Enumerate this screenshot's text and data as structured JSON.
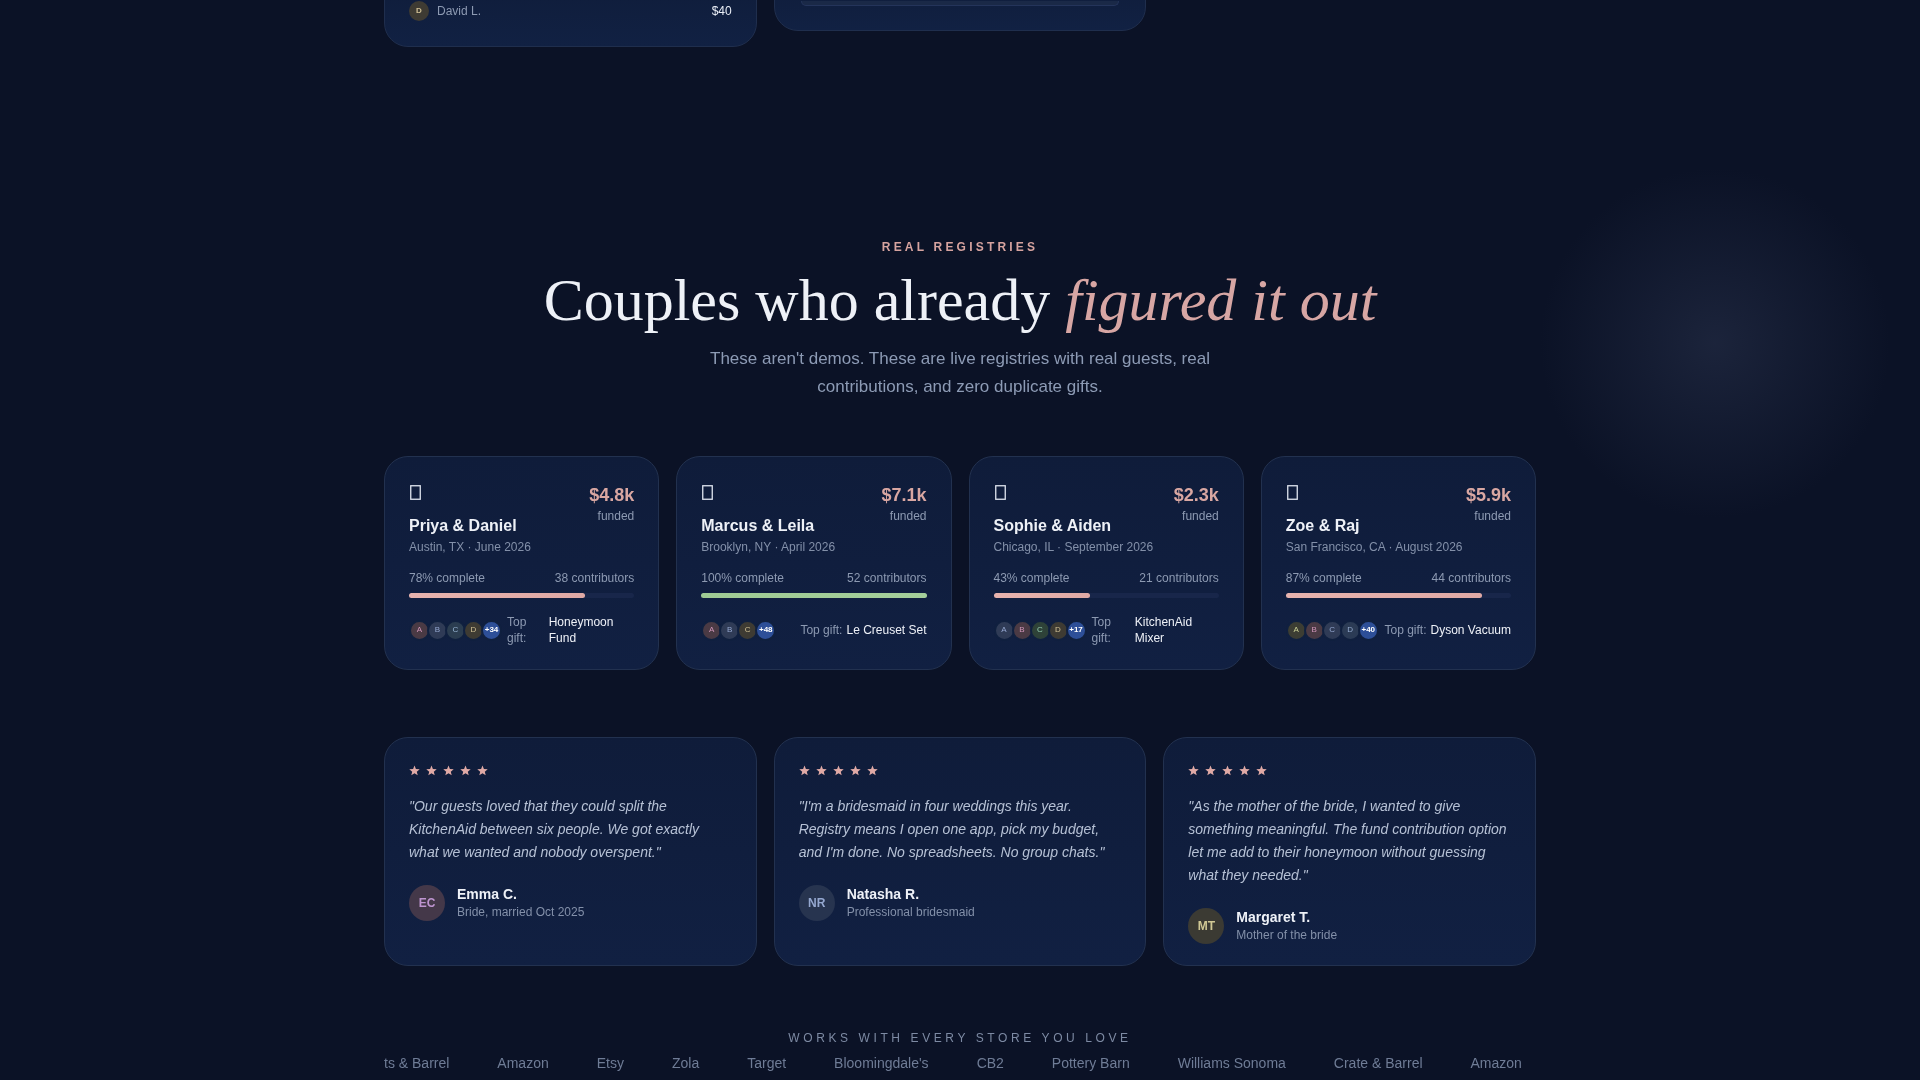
{
  "previous_cards": [
    {
      "kind": "contributions",
      "rows": [
        {
          "initial": "D",
          "name": "David L.",
          "amount": "$40",
          "color": "#3e3b33"
        }
      ]
    },
    {
      "kind": "bar"
    }
  ],
  "registries_section": {
    "eyebrow": "REAL REGISTRIES",
    "title": "Couples who already *figured it out*",
    "subtitle": "These aren't demos. These are live registries with real guests, real contributions, and zero duplicate gifts."
  },
  "registries": [
    {
      "amount": "$4.8k",
      "amount_label": "funded",
      "couple": "Priya & Daniel",
      "place": "Austin, TX · June 2026",
      "progress_label": "78% complete",
      "contributors": "38 contributors",
      "level": 0.78,
      "avatars": [
        {
          "letter": "A",
          "color": "#4a3a44"
        },
        {
          "letter": "B",
          "color": "#2f3b56"
        },
        {
          "letter": "C",
          "color": "#2b3d50"
        },
        {
          "letter": "D",
          "color": "#3e3b33"
        }
      ],
      "more": "+34",
      "gift_label": "Top gift:",
      "gift": "Honeymoon Fund"
    },
    {
      "amount": "$7.1k",
      "amount_label": "funded",
      "couple": "Marcus & Leila",
      "place": "Brooklyn, NY · April 2026",
      "progress_label": "100% complete",
      "contributors": "52 contributors",
      "level": 1,
      "avatars": [
        {
          "letter": "A",
          "color": "#4a3a44"
        },
        {
          "letter": "B",
          "color": "#2f3b56"
        },
        {
          "letter": "C",
          "color": "#3e3b33"
        }
      ],
      "more": "+48",
      "gift_label": "Top gift:",
      "gift": "Le Creuset Set"
    },
    {
      "amount": "$2.3k",
      "amount_label": "funded",
      "couple": "Sophie & Aiden",
      "place": "Chicago, IL · September 2026",
      "progress_label": "43% complete",
      "contributors": "21 contributors",
      "level": 0.43,
      "avatars": [
        {
          "letter": "A",
          "color": "#2f3b56"
        },
        {
          "letter": "B",
          "color": "#4a3a44"
        },
        {
          "letter": "C",
          "color": "#2e4238"
        },
        {
          "letter": "D",
          "color": "#3e3b33"
        }
      ],
      "more": "+17",
      "gift_label": "Top gift:",
      "gift": "KitchenAid Mixer"
    },
    {
      "amount": "$5.9k",
      "amount_label": "funded",
      "couple": "Zoe & Raj",
      "place": "San Francisco, CA · August 2026",
      "progress_label": "87% complete",
      "contributors": "44 contributors",
      "level": 0.87,
      "avatars": [
        {
          "letter": "A",
          "color": "#3c3d33"
        },
        {
          "letter": "B",
          "color": "#4a3a44"
        },
        {
          "letter": "C",
          "color": "#2f3b56"
        },
        {
          "letter": "D",
          "color": "#2b3b55"
        }
      ],
      "more": "+40",
      "gift_label": "Top gift:",
      "gift": "Dyson Vacuum"
    }
  ],
  "testimonials": [
    {
      "stars": 5,
      "quote": "\"Our guests loved that they could split the KitchenAid between six people. We got exactly what we wanted and nobody overspent.\"",
      "initials": "EC",
      "color": "#443849",
      "name": "Emma C.",
      "role": "Bride, married Oct 2025"
    },
    {
      "stars": 5,
      "quote": "\"I'm a bridesmaid in four weddings this year. Registry means I open one app, pick my budget, and I'm done. No spreadsheets. No group chats.\"",
      "initials": "NR",
      "color": "#27344f",
      "name": "Natasha R.",
      "role": "Professional bridesmaid"
    },
    {
      "stars": 5,
      "quote": "\"As the mother of the bride, I wanted to give something meaningful. The fund contribution option let me add to their honeymoon without guessing what they needed.\"",
      "initials": "MT",
      "color": "#3b3a33",
      "name": "Margaret T.",
      "role": "Mother of the bride"
    }
  ],
  "stores": {
    "title": "WORKS WITH EVERY STORE YOU LOVE",
    "names": [
      "ts & Barrel",
      "Amazon",
      "Etsy",
      "Zola",
      "Target",
      "Bloomingdale's",
      "CB2",
      "Pottery Barn",
      "Williams Sonoma",
      "Crate & Barrel",
      "Amazon"
    ]
  }
}
